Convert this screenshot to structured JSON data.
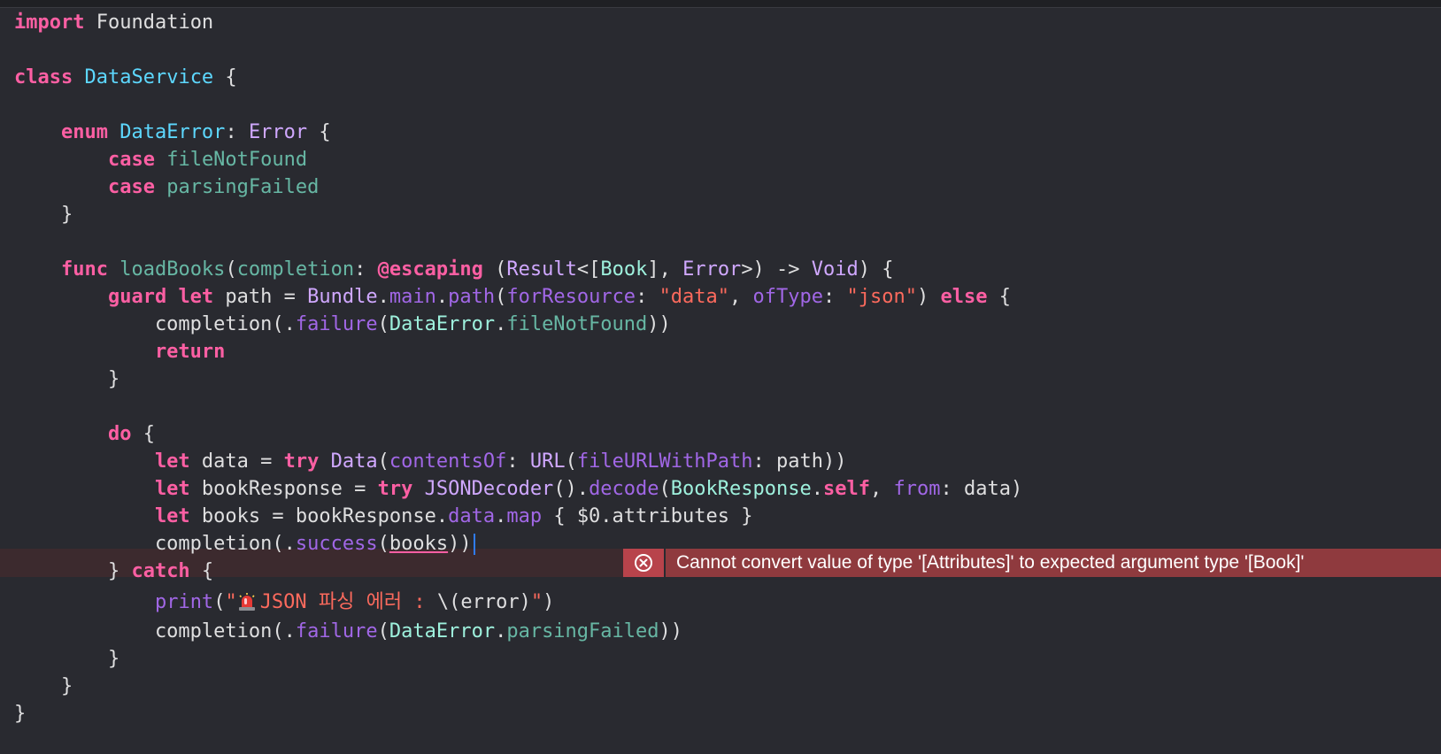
{
  "editor": {
    "lines": [
      [
        {
          "t": "import",
          "c": "kw"
        },
        {
          "t": " Foundation",
          "c": "pl"
        }
      ],
      [],
      [
        {
          "t": "class",
          "c": "kw"
        },
        {
          "t": " ",
          "c": "pl"
        },
        {
          "t": "DataService",
          "c": "dc"
        },
        {
          "t": " {",
          "c": "pl"
        }
      ],
      [],
      [
        {
          "t": "    enum",
          "c": "kw"
        },
        {
          "t": " ",
          "c": "pl"
        },
        {
          "t": "DataError",
          "c": "dc"
        },
        {
          "t": ": ",
          "c": "pl"
        },
        {
          "t": "Error",
          "c": "ty"
        },
        {
          "t": " {",
          "c": "pl"
        }
      ],
      [
        {
          "t": "        case",
          "c": "kw"
        },
        {
          "t": " ",
          "c": "pl"
        },
        {
          "t": "fileNotFound",
          "c": "fn"
        }
      ],
      [
        {
          "t": "        case",
          "c": "kw"
        },
        {
          "t": " ",
          "c": "pl"
        },
        {
          "t": "parsingFailed",
          "c": "fn"
        }
      ],
      [
        {
          "t": "    }",
          "c": "pl"
        }
      ],
      [],
      [
        {
          "t": "    func",
          "c": "kw"
        },
        {
          "t": " ",
          "c": "pl"
        },
        {
          "t": "loadBooks",
          "c": "fn"
        },
        {
          "t": "(",
          "c": "pl"
        },
        {
          "t": "completion",
          "c": "fn"
        },
        {
          "t": ": ",
          "c": "pl"
        },
        {
          "t": "@escaping",
          "c": "kw"
        },
        {
          "t": " (",
          "c": "pl"
        },
        {
          "t": "Result",
          "c": "ty"
        },
        {
          "t": "<[",
          "c": "pl"
        },
        {
          "t": "Book",
          "c": "pty"
        },
        {
          "t": "], ",
          "c": "pl"
        },
        {
          "t": "Error",
          "c": "ty"
        },
        {
          "t": ">) -> ",
          "c": "pl"
        },
        {
          "t": "Void",
          "c": "ty"
        },
        {
          "t": ") {",
          "c": "pl"
        }
      ],
      [
        {
          "t": "        guard",
          "c": "kw"
        },
        {
          "t": " ",
          "c": "pl"
        },
        {
          "t": "let",
          "c": "kw"
        },
        {
          "t": " path = ",
          "c": "pl"
        },
        {
          "t": "Bundle",
          "c": "ty"
        },
        {
          "t": ".",
          "c": "pl"
        },
        {
          "t": "main",
          "c": "prj"
        },
        {
          "t": ".",
          "c": "pl"
        },
        {
          "t": "path",
          "c": "prj"
        },
        {
          "t": "(",
          "c": "pl"
        },
        {
          "t": "forResource",
          "c": "prj"
        },
        {
          "t": ": ",
          "c": "pl"
        },
        {
          "t": "\"data\"",
          "c": "str"
        },
        {
          "t": ", ",
          "c": "pl"
        },
        {
          "t": "ofType",
          "c": "prj"
        },
        {
          "t": ": ",
          "c": "pl"
        },
        {
          "t": "\"json\"",
          "c": "str"
        },
        {
          "t": ") ",
          "c": "pl"
        },
        {
          "t": "else",
          "c": "kw"
        },
        {
          "t": " {",
          "c": "pl"
        }
      ],
      [
        {
          "t": "            completion(.",
          "c": "pl"
        },
        {
          "t": "failure",
          "c": "prj"
        },
        {
          "t": "(",
          "c": "pl"
        },
        {
          "t": "DataError",
          "c": "pty"
        },
        {
          "t": ".",
          "c": "pl"
        },
        {
          "t": "fileNotFound",
          "c": "fn"
        },
        {
          "t": "))",
          "c": "pl"
        }
      ],
      [
        {
          "t": "            return",
          "c": "kw"
        }
      ],
      [
        {
          "t": "        }",
          "c": "pl"
        }
      ],
      [],
      [
        {
          "t": "        do",
          "c": "kw"
        },
        {
          "t": " {",
          "c": "pl"
        }
      ],
      [
        {
          "t": "            let",
          "c": "kw"
        },
        {
          "t": " data = ",
          "c": "pl"
        },
        {
          "t": "try",
          "c": "kw"
        },
        {
          "t": " ",
          "c": "pl"
        },
        {
          "t": "Data",
          "c": "ty"
        },
        {
          "t": "(",
          "c": "pl"
        },
        {
          "t": "contentsOf",
          "c": "prj"
        },
        {
          "t": ": ",
          "c": "pl"
        },
        {
          "t": "URL",
          "c": "ty"
        },
        {
          "t": "(",
          "c": "pl"
        },
        {
          "t": "fileURLWithPath",
          "c": "prj"
        },
        {
          "t": ": path))",
          "c": "pl"
        }
      ],
      [
        {
          "t": "            let",
          "c": "kw"
        },
        {
          "t": " bookResponse = ",
          "c": "pl"
        },
        {
          "t": "try",
          "c": "kw"
        },
        {
          "t": " ",
          "c": "pl"
        },
        {
          "t": "JSONDecoder",
          "c": "ty"
        },
        {
          "t": "().",
          "c": "pl"
        },
        {
          "t": "decode",
          "c": "prj"
        },
        {
          "t": "(",
          "c": "pl"
        },
        {
          "t": "BookResponse",
          "c": "pty"
        },
        {
          "t": ".",
          "c": "pl"
        },
        {
          "t": "self",
          "c": "kw"
        },
        {
          "t": ", ",
          "c": "pl"
        },
        {
          "t": "from",
          "c": "prj"
        },
        {
          "t": ": data)",
          "c": "pl"
        }
      ],
      [
        {
          "t": "            let",
          "c": "kw"
        },
        {
          "t": " books = bookResponse.",
          "c": "pl"
        },
        {
          "t": "data",
          "c": "prj"
        },
        {
          "t": ".",
          "c": "pl"
        },
        {
          "t": "map",
          "c": "prj"
        },
        {
          "t": " { $0.attributes }",
          "c": "pl"
        }
      ],
      [
        {
          "t": "            completion(.",
          "c": "pl"
        },
        {
          "t": "success",
          "c": "prj"
        },
        {
          "t": "(",
          "c": "pl"
        },
        {
          "t": "books",
          "c": "pl",
          "u": true
        },
        {
          "t": "))",
          "c": "pl"
        },
        {
          "caret": true
        }
      ],
      [
        {
          "t": "        } ",
          "c": "pl"
        },
        {
          "t": "catch",
          "c": "kw"
        },
        {
          "t": " {",
          "c": "pl"
        }
      ],
      [
        {
          "t": "            ",
          "c": "pl"
        },
        {
          "t": "print",
          "c": "prj"
        },
        {
          "t": "(",
          "c": "pl"
        },
        {
          "t": "\"",
          "c": "str"
        },
        {
          "emoji": "siren"
        },
        {
          "t": "JSON 파싱 에러 : ",
          "c": "str"
        },
        {
          "t": "\\(error)",
          "c": "pl"
        },
        {
          "t": "\"",
          "c": "str"
        },
        {
          "t": ")",
          "c": "pl"
        }
      ],
      [
        {
          "t": "            completion(.",
          "c": "pl"
        },
        {
          "t": "failure",
          "c": "prj"
        },
        {
          "t": "(",
          "c": "pl"
        },
        {
          "t": "DataError",
          "c": "pty"
        },
        {
          "t": ".",
          "c": "pl"
        },
        {
          "t": "parsingFailed",
          "c": "fn"
        },
        {
          "t": "))",
          "c": "pl"
        }
      ],
      [
        {
          "t": "        }",
          "c": "pl"
        }
      ],
      [
        {
          "t": "    }",
          "c": "pl"
        }
      ],
      [
        {
          "t": "}",
          "c": "pl"
        }
      ]
    ],
    "error": {
      "message": "Cannot convert value of type '[Attributes]' to expected argument type '[Book]'",
      "line_index": 19
    },
    "icons": {
      "error": "error-circle-x-icon",
      "emoji": "siren-emoji-icon"
    },
    "colors": {
      "background": "#292a30",
      "keyword": "#fc5fa3",
      "type": "#d0a8ff",
      "declaration": "#5dd8ff",
      "function": "#67b7a4",
      "project": "#a167e6",
      "string": "#fc6a5d",
      "plain": "#dfdfe0",
      "error_bg": "#8f3a3e",
      "error_icon_bg": "#b8434b"
    }
  }
}
